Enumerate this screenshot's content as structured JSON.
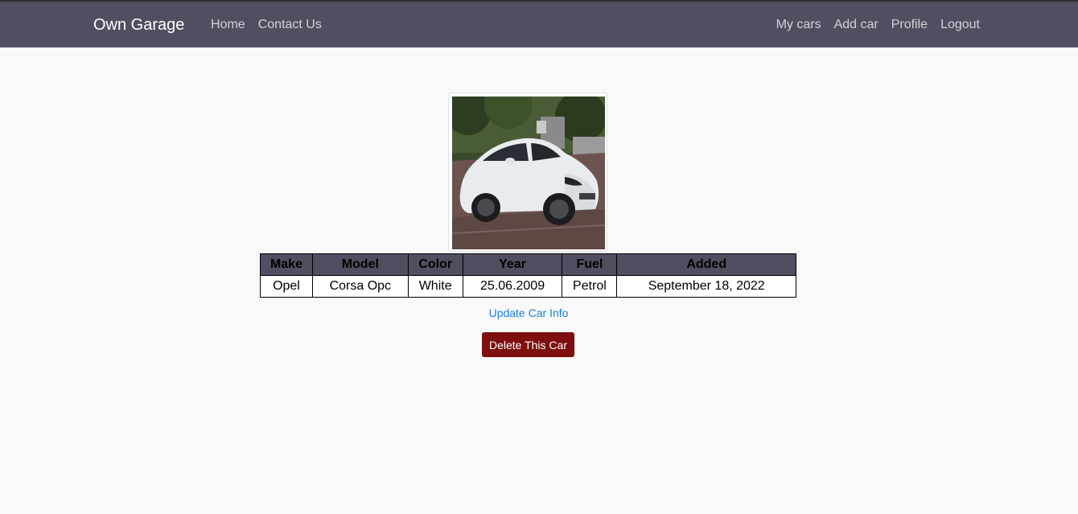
{
  "navbar": {
    "brand": "Own Garage",
    "left_links": [
      "Home",
      "Contact Us"
    ],
    "right_links": [
      "My cars",
      "Add car",
      "Profile",
      "Logout"
    ]
  },
  "car": {
    "image_alt": "car-photo",
    "table": {
      "headers": [
        "Make",
        "Model",
        "Color",
        "Year",
        "Fuel",
        "Added"
      ],
      "row": [
        "Opel",
        "Corsa Opc",
        "White",
        "25.06.2009",
        "Petrol",
        "September 18, 2022"
      ]
    }
  },
  "actions": {
    "update_label": "Update Car Info",
    "delete_label": "Delete This Car"
  },
  "colors": {
    "navbar_bg": "#4f4f61",
    "delete_bg": "#7e0f0f",
    "link": "#1a7fe3"
  }
}
